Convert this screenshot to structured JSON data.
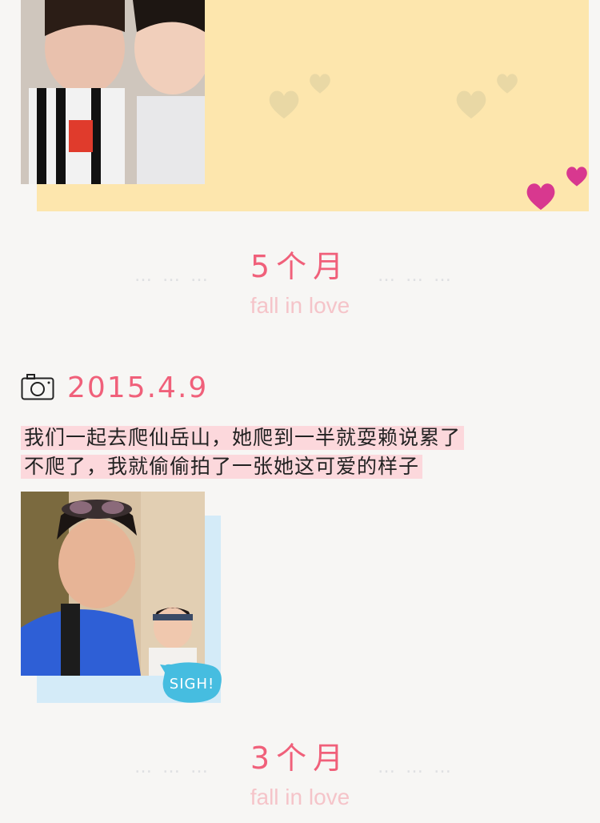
{
  "sections": [
    {
      "month": "5个月",
      "subtitle": "fall in love",
      "dots_left": "… … …",
      "dots_right": "… … …"
    },
    {
      "month": "3个月",
      "subtitle": "fall in love",
      "dots_left": "… … …",
      "dots_right": "… … …"
    }
  ],
  "entry": {
    "date": "2015.4.9",
    "caption_lines": [
      "我们一起去爬仙岳山，她爬到一半就耍赖说累了",
      "不爬了，我就偷偷拍了一张她这可爱的样子"
    ],
    "sticker": "SIGH!"
  },
  "colors": {
    "accent": "#f0607a",
    "highlight": "#fcd8dc",
    "card_yellow": "#fde6ad",
    "card_blue": "#d4ebf8"
  },
  "icons": [
    "camera-icon",
    "heart-icon"
  ]
}
